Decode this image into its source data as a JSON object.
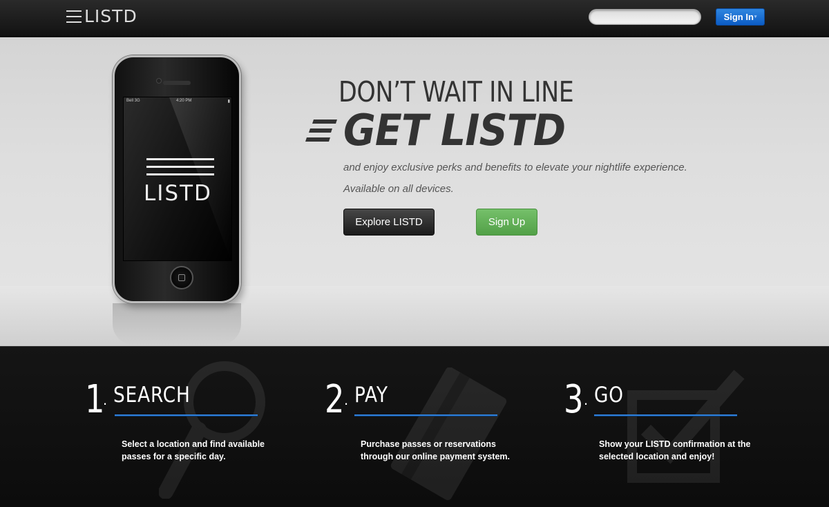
{
  "navbar": {
    "logo_text": "LISTD",
    "search_placeholder": "",
    "signin_label": "Sign In",
    "signin_caret": "▾"
  },
  "hero": {
    "phone": {
      "carrier": "Bell 3G",
      "time": "4:20 PM",
      "screen_logo": "LISTD"
    },
    "title_line1": "DON’T WAIT IN LINE",
    "title_line2": "GET LISTD",
    "subtitle_line1": "and enjoy exclusive perks and benefits to elevate your nightlife experience.",
    "subtitle_line2": "Available on all devices.",
    "explore_label": "Explore LISTD",
    "signup_label": "Sign Up"
  },
  "steps": [
    {
      "number": "1",
      "title": "SEARCH",
      "description": "Select a location and find available passes for a specific day.",
      "icon": "magnifier-icon"
    },
    {
      "number": "2",
      "title": "PAY",
      "description": "Purchase passes or reservations through our online payment system.",
      "icon": "credit-card-icon"
    },
    {
      "number": "3",
      "title": "GO",
      "description": "Show your LISTD confirmation at the selected location and enjoy!",
      "icon": "checkbox-icon"
    }
  ],
  "colors": {
    "accent_blue": "#2f7fd9",
    "signup_green": "#5fae54",
    "dark_bg": "#111111"
  }
}
